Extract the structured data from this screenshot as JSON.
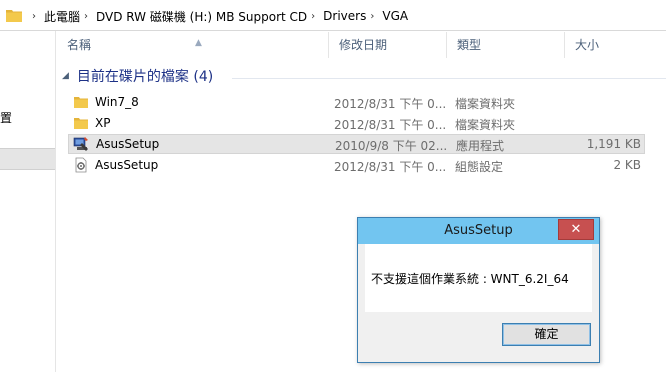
{
  "address_bar": {
    "breadcrumbs": [
      "此電腦",
      "DVD RW 磁碟機 (H:) MB Support CD",
      "Drivers",
      "VGA"
    ],
    "separator": "›"
  },
  "nav_pane": {
    "visible_fragment": "置"
  },
  "columns": {
    "name": "名稱",
    "date": "修改日期",
    "type": "類型",
    "size": "大小"
  },
  "group": {
    "title": "目前在碟片的檔案 (4)"
  },
  "files": [
    {
      "name": "Win7_8",
      "date": "2012/8/31 下午 0...",
      "type": "檔案資料夾",
      "size": "",
      "icon": "folder-icon"
    },
    {
      "name": "XP",
      "date": "2012/8/31 下午 0...",
      "type": "檔案資料夾",
      "size": "",
      "icon": "folder-icon"
    },
    {
      "name": "AsusSetup",
      "date": "2010/9/8 下午 02...",
      "type": "應用程式",
      "size": "1,191 KB",
      "icon": "setup-app-icon"
    },
    {
      "name": "AsusSetup",
      "date": "2012/8/31 下午 0...",
      "type": "組態設定",
      "size": "2 KB",
      "icon": "config-file-icon"
    }
  ],
  "dialog": {
    "title": "AsusSetup",
    "close_glyph": "✕",
    "message": "不支援這個作業系統 : WNT_6.2I_64",
    "ok_label": "確定"
  },
  "colors": {
    "folder": "#f3c94c",
    "dialog_titlebar": "#72c5f0",
    "close_button": "#c75050",
    "group_title": "#1e3287",
    "selection": "#e5e5e5"
  }
}
